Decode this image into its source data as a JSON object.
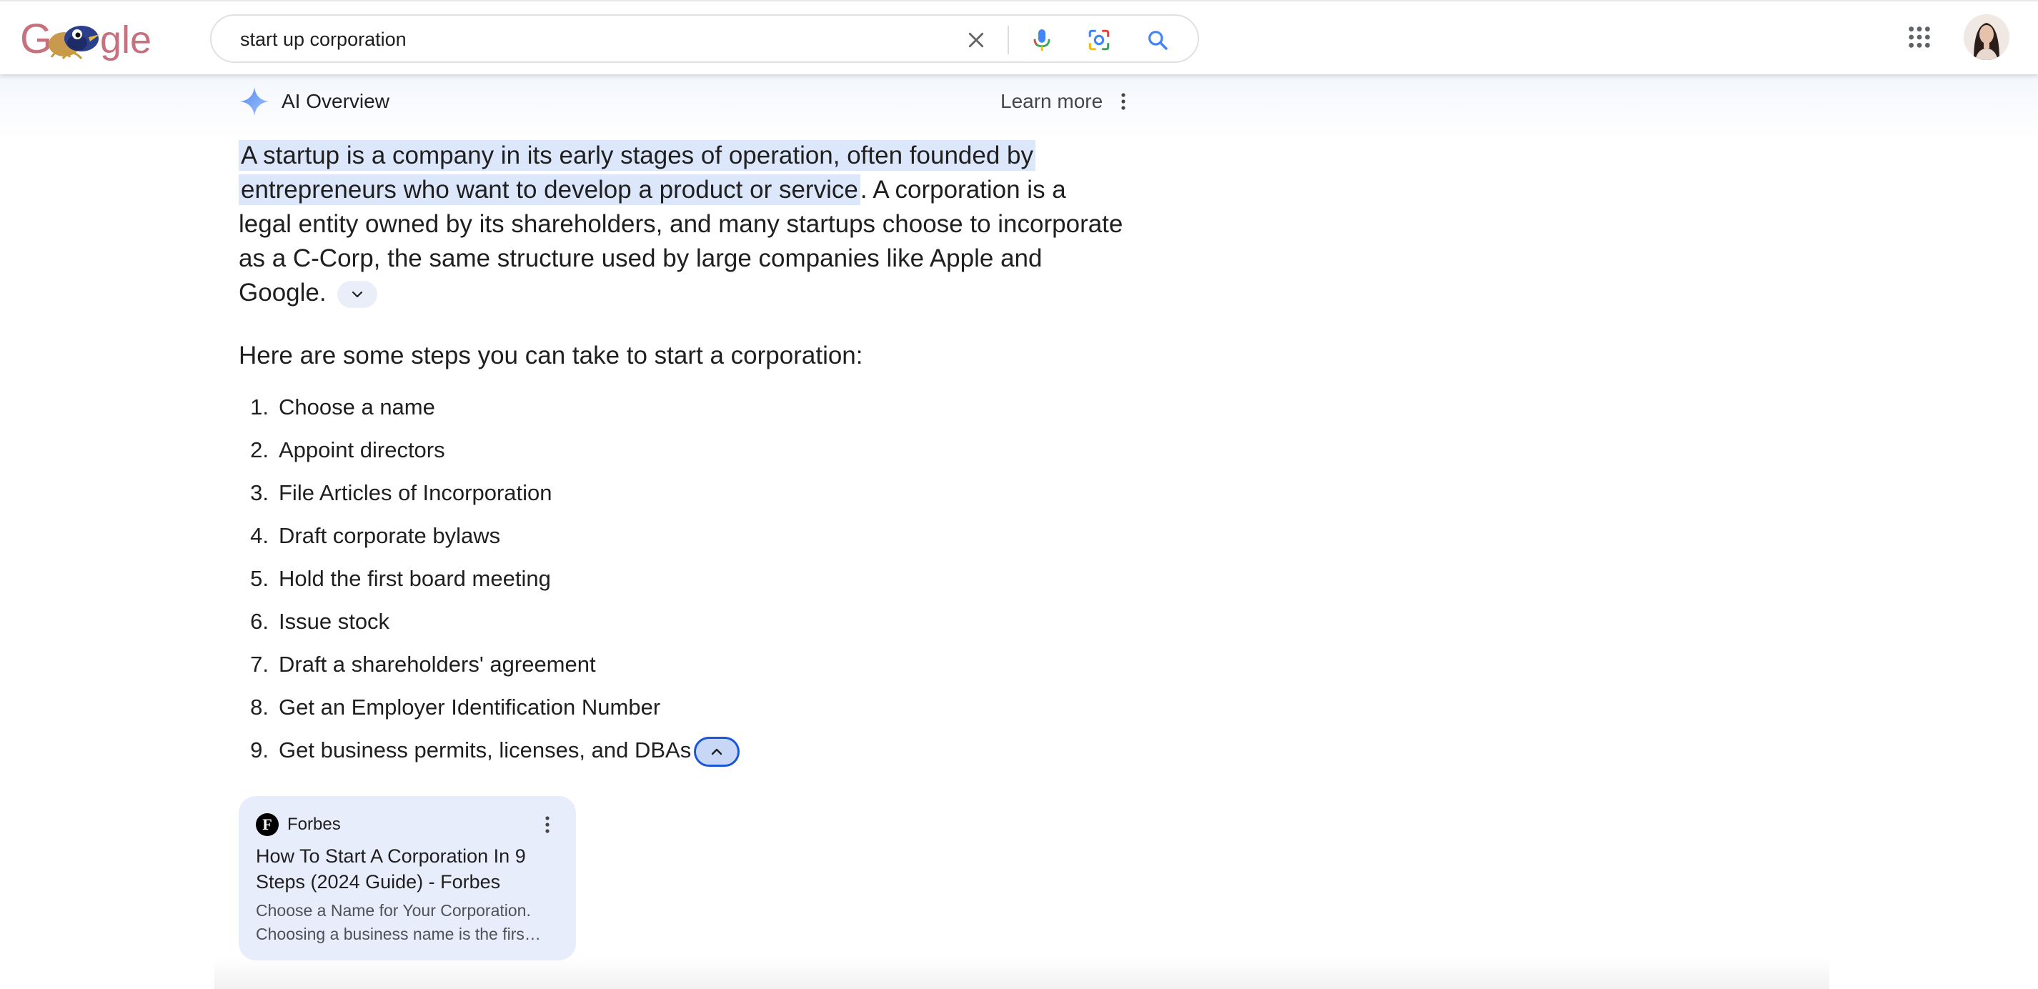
{
  "header": {
    "logo_text": "Google",
    "search": {
      "query": "start up corporation",
      "clear_label": "Clear",
      "voice_label": "Search by voice",
      "lens_label": "Search by image",
      "submit_label": "Search"
    },
    "apps_label": "Google apps",
    "account_label": "Google Account"
  },
  "ai_overview": {
    "title": "AI Overview",
    "learn_more": "Learn more",
    "summary": {
      "highlight_line1": "A startup is a company in its early stages of operation, often founded by",
      "highlight_line2": "entrepreneurs who want to develop a product or service",
      "rest": ". A corporation is a legal entity owned by its shareholders, and many startups choose to incorporate as a C-Corp, the same structure used by large companies like Apple and Google."
    },
    "steps_intro": "Here are some steps you can take to start a corporation:",
    "steps": [
      {
        "num": "1.",
        "text": "Choose a name"
      },
      {
        "num": "2.",
        "text": "Appoint directors"
      },
      {
        "num": "3.",
        "text": "File Articles of Incorporation"
      },
      {
        "num": "4.",
        "text": "Draft corporate bylaws"
      },
      {
        "num": "5.",
        "text": "Hold the first board meeting"
      },
      {
        "num": "6.",
        "text": "Issue stock"
      },
      {
        "num": "7.",
        "text": "Draft a shareholders' agreement"
      },
      {
        "num": "8.",
        "text": "Get an Employer Identification Number"
      },
      {
        "num": "9.",
        "text": "Get business permits, licenses, and DBAs"
      }
    ],
    "source": {
      "logo_letter": "F",
      "name": "Forbes",
      "title": "How To Start A Corporation In 9 Steps (2024 Guide) - Forbes",
      "snippet_line1": "Choose a Name for Your Corporation.",
      "snippet_line2": "Choosing a business name is the firs…"
    }
  },
  "colors": {
    "accent_blue": "#1a73e8",
    "highlight": "#dde7fb",
    "card_bg": "#e8edfb"
  }
}
